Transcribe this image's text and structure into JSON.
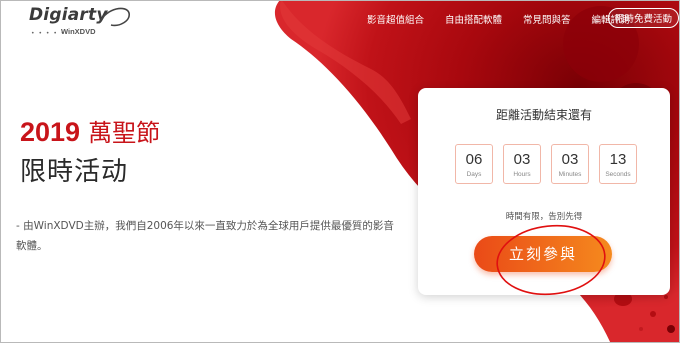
{
  "header": {
    "logo": {
      "brand": "Digiarty",
      "sub": "WinXDVD",
      "dots": "• • • • •"
    },
    "nav": [
      "影音超值組合",
      "自由搭配軟體",
      "常見問與答",
      "編輯評測"
    ],
    "cta": "限時免費活動"
  },
  "hero": {
    "year": "2019",
    "festival": "萬聖節",
    "subtitle": "限時活动",
    "description": "- 由WinXDVD主辦，我們自2006年以來一直致力於為全球用戶提供最優質的影音軟體。"
  },
  "countdown": {
    "title": "距離活動結束還有",
    "units": [
      {
        "value": "06",
        "label": "Days"
      },
      {
        "value": "03",
        "label": "Hours"
      },
      {
        "value": "03",
        "label": "Minutes"
      },
      {
        "value": "13",
        "label": "Seconds"
      }
    ],
    "limited_note": "時間有限，告別先得",
    "join_label": "立刻參與"
  },
  "colors": {
    "brand_red": "#c8141a",
    "button_orange": "#ea4a17",
    "annotation_red": "#e01010"
  }
}
